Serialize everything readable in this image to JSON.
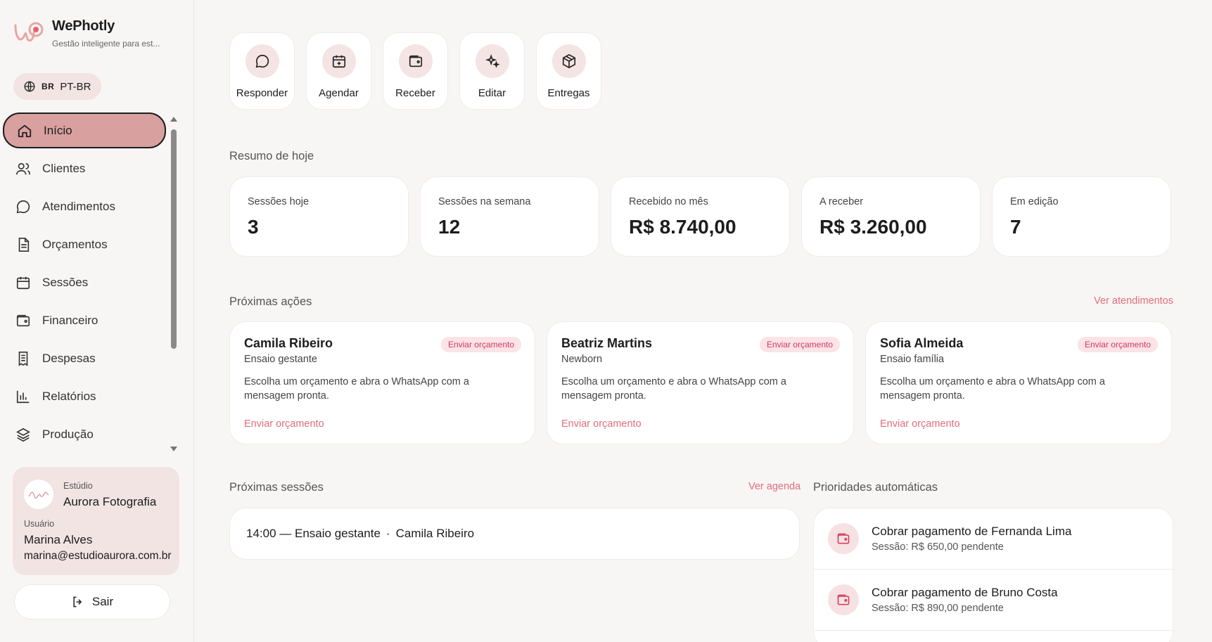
{
  "brand": {
    "name": "WePhotly",
    "subtitle": "Gestão inteligente para est..."
  },
  "language": {
    "code": "BR",
    "label": "PT-BR"
  },
  "nav": {
    "items": [
      {
        "label": "Início",
        "icon": "home-icon"
      },
      {
        "label": "Clientes",
        "icon": "users-icon"
      },
      {
        "label": "Atendimentos",
        "icon": "chat-icon"
      },
      {
        "label": "Orçamentos",
        "icon": "document-icon"
      },
      {
        "label": "Sessões",
        "icon": "calendar-icon"
      },
      {
        "label": "Financeiro",
        "icon": "wallet-icon"
      },
      {
        "label": "Despesas",
        "icon": "receipt-icon"
      },
      {
        "label": "Relatórios",
        "icon": "bar-chart-icon"
      },
      {
        "label": "Produção",
        "icon": "layers-icon"
      }
    ]
  },
  "studio": {
    "label": "Estúdio",
    "name": "Aurora Fotografia",
    "user_label": "Usuário",
    "user_name": "Marina Alves",
    "user_email": "marina@estudioaurora.com.br"
  },
  "logout_label": "Sair",
  "quick_actions": [
    {
      "label": "Responder",
      "icon": "chat-icon"
    },
    {
      "label": "Agendar",
      "icon": "calendar-plus-icon"
    },
    {
      "label": "Receber",
      "icon": "wallet-icon"
    },
    {
      "label": "Editar",
      "icon": "sparkles-icon"
    },
    {
      "label": "Entregas",
      "icon": "package-icon"
    }
  ],
  "summary": {
    "title": "Resumo de hoje",
    "stats": [
      {
        "label": "Sessões hoje",
        "value": "3"
      },
      {
        "label": "Sessões na semana",
        "value": "12"
      },
      {
        "label": "Recebido no mês",
        "value": "R$ 8.740,00"
      },
      {
        "label": "A receber",
        "value": "R$ 3.260,00"
      },
      {
        "label": "Em edição",
        "value": "7"
      }
    ]
  },
  "next_actions": {
    "title": "Próximas ações",
    "link": "Ver atendimentos",
    "cards": [
      {
        "name": "Camila Ribeiro",
        "type": "Ensaio gestante",
        "badge": "Enviar orçamento",
        "desc": "Escolha um orçamento e abra o WhatsApp com a mensagem pronta.",
        "link": "Enviar orçamento"
      },
      {
        "name": "Beatriz Martins",
        "type": "Newborn",
        "badge": "Enviar orçamento",
        "desc": "Escolha um orçamento e abra o WhatsApp com a mensagem pronta.",
        "link": "Enviar orçamento"
      },
      {
        "name": "Sofia Almeida",
        "type": "Ensaio família",
        "badge": "Enviar orçamento",
        "desc": "Escolha um orçamento e abra o WhatsApp com a mensagem pronta.",
        "link": "Enviar orçamento"
      }
    ]
  },
  "next_sessions": {
    "title": "Próximas sessões",
    "link": "Ver agenda",
    "items": [
      {
        "text": "14:00 — Ensaio gestante",
        "sep": "·",
        "client": "Camila Ribeiro"
      }
    ]
  },
  "priorities": {
    "title": "Prioridades automáticas",
    "items": [
      {
        "title": "Cobrar pagamento de Fernanda Lima",
        "sub": "Sessão: R$ 650,00 pendente"
      },
      {
        "title": "Cobrar pagamento de Bruno Costa",
        "sub": "Sessão: R$ 890,00 pendente"
      }
    ]
  },
  "colors": {
    "accent": "#e26d7a",
    "active_nav": "#d8a09e",
    "soft_pink": "#f1e4e2"
  }
}
